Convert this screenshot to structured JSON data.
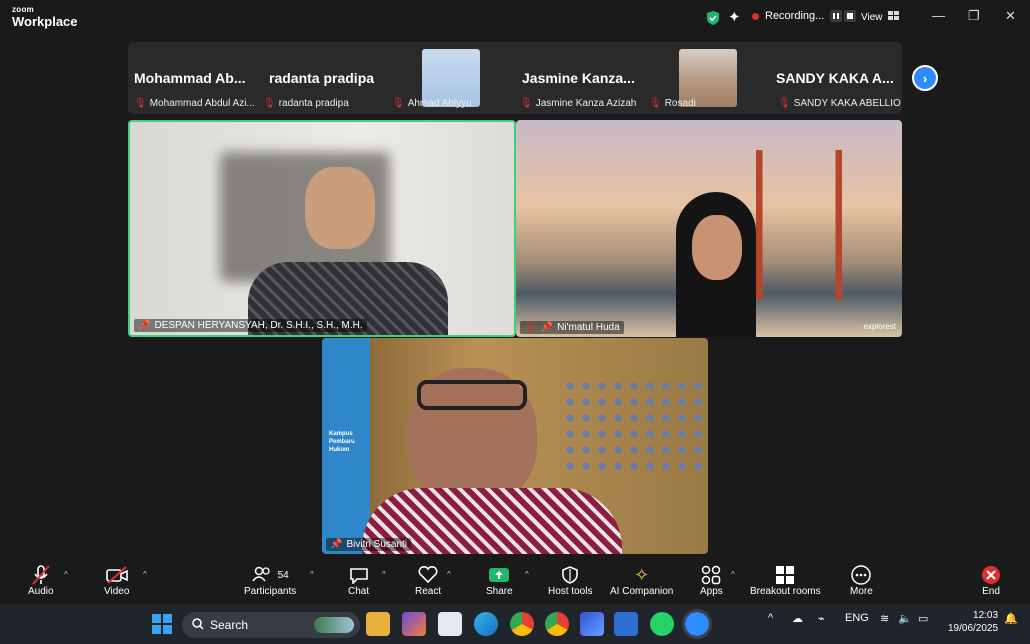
{
  "app": {
    "brand_top": "zoom",
    "brand_bottom": "Workplace"
  },
  "titlebar": {
    "recording_label": "Recording...",
    "view_label": "View",
    "minimize": "—",
    "restore": "❐",
    "close": "✕"
  },
  "participants_strip": [
    {
      "big": "Mohammad  Ab...",
      "small": "Mohammad Abdul Azi..."
    },
    {
      "big": "radanta pradipa",
      "small": "radanta pradipa"
    },
    {
      "big": "",
      "small": "Ahmad Ablyyu"
    },
    {
      "big": "Jasmine  Kanza...",
      "small": "Jasmine Kanza Azizah"
    },
    {
      "big": "",
      "small": "Rosadi"
    },
    {
      "big": "SANDY  KAKA  A...",
      "small": "SANDY KAKA ABELLIO"
    }
  ],
  "video_tiles": [
    {
      "name": "DESPAN HERYANSYAH, Dr. S.H.I., S.H., M.H."
    },
    {
      "name": "Ni'matul Huda",
      "watermark": "explorest"
    },
    {
      "name": "Bivitri Susanti",
      "banner": "Kampus Pembaru Hukum"
    }
  ],
  "toolbar": {
    "audio": "Audio",
    "video": "Video",
    "participants": "Participants",
    "participants_count": "54",
    "chat": "Chat",
    "react": "React",
    "share": "Share",
    "host_tools": "Host tools",
    "ai_companion": "AI Companion",
    "apps": "Apps",
    "breakout": "Breakout rooms",
    "more": "More",
    "end": "End"
  },
  "taskbar": {
    "search_placeholder": "Search",
    "lang": "ENG",
    "time": "12:03",
    "date": "19/06/2025"
  },
  "colors": {
    "accent": "#2d8cff",
    "active_speaker": "#3fd07a",
    "share_green": "#1fb86a",
    "end_red": "#e02f2f"
  }
}
